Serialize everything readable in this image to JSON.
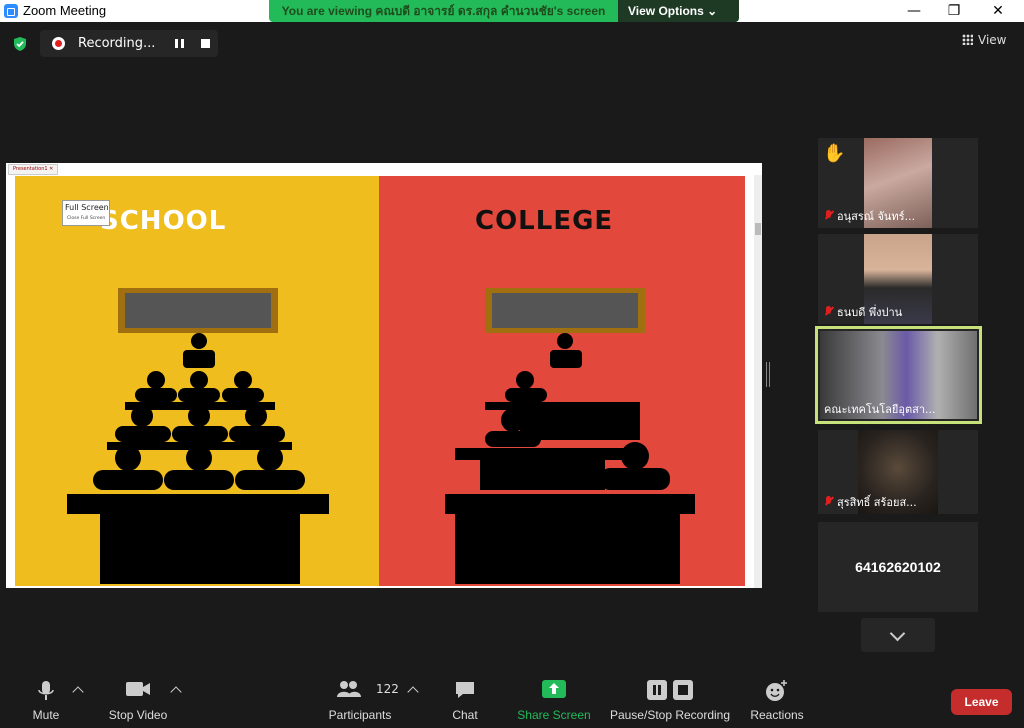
{
  "window": {
    "title": "Zoom Meeting",
    "minimize": "—",
    "maximize": "❐",
    "close": "✕"
  },
  "share_banner": {
    "message": "You are viewing คณบดี อาจารย์ ดร.สกุล คำนวนชัย's screen",
    "view_options": "View Options ⌄"
  },
  "recording": {
    "label": "Recording..."
  },
  "view_button": {
    "label": "View"
  },
  "shared_screen": {
    "tab_label": "Presentation1 ✕",
    "popup_title": "Full Screen",
    "popup_sub": "Close Full Screen",
    "left_title": "SCHOOL",
    "right_title": "COLLEGE",
    "colors": {
      "left": "#f0bd1e",
      "right": "#e2483b"
    }
  },
  "participants": [
    {
      "name": "อนุสรณ์ จันทร์...",
      "muted": true,
      "hand_raised": true,
      "hand_icon": "✋"
    },
    {
      "name": "ธนบดี พึ่งปาน",
      "muted": true
    },
    {
      "name": "คณะเทคโนโลยีอุตสา...",
      "muted": false,
      "active_speaker": true
    },
    {
      "name": "สุรสิทธิ์ สร้อยส...",
      "muted": true
    },
    {
      "name": "64162620102",
      "no_video": true
    }
  ],
  "toolbar": {
    "mute": "Mute",
    "stop_video": "Stop Video",
    "participants": "Participants",
    "participant_count": "122",
    "chat": "Chat",
    "share_screen": "Share Screen",
    "pause_stop_recording": "Pause/Stop Recording",
    "reactions": "Reactions",
    "leave": "Leave"
  },
  "accent_colors": {
    "share_green": "#23ba5a",
    "leave_red": "#c52c2c",
    "active_border": "#c6e07a"
  }
}
